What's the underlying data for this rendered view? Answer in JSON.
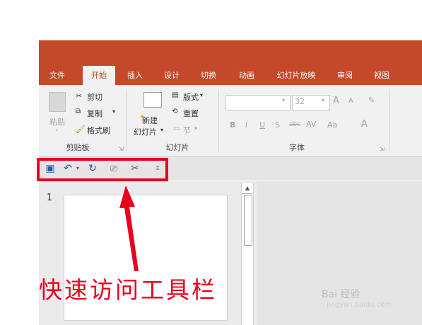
{
  "ribbon_tabs": [
    {
      "label": "文件"
    },
    {
      "label": "开始",
      "active": true
    },
    {
      "label": "插入"
    },
    {
      "label": "设计"
    },
    {
      "label": "切换"
    },
    {
      "label": "动画"
    },
    {
      "label": "幻灯片放映"
    },
    {
      "label": "审阅"
    },
    {
      "label": "视图"
    }
  ],
  "clipboard": {
    "paste": "粘贴",
    "cut": "剪切",
    "copy": "复制",
    "format_painter": "格式刷",
    "group_label": "剪贴板"
  },
  "slides": {
    "new_slide_line1": "新建",
    "new_slide_line2": "幻灯片",
    "layout": "版式",
    "reset": "重置",
    "section": "节",
    "group_label": "幻灯片"
  },
  "font": {
    "size_value": "32",
    "bold": "B",
    "italic": "I",
    "underline": "U",
    "shadow": "S",
    "strikethrough": "abc",
    "spacing": "AV",
    "case": "Aa",
    "color": "A",
    "grow": "A",
    "shrink": "A",
    "group_label": "字体"
  },
  "qat": {
    "save_icon": "save-icon",
    "undo_icon": "undo-icon",
    "redo_icon": "repeat-icon",
    "start_show_icon": "slideshow-icon",
    "cut_icon": "scissors-icon",
    "customize_icon": "customize-icon"
  },
  "slide_panel": {
    "slide_number": "1"
  },
  "annotation": {
    "text": "快速访问工具栏"
  },
  "watermark": {
    "text": "Bai 经验",
    "sub": "jingyan.baidu.com"
  },
  "colors": {
    "accent": "#c4482a",
    "highlight": "#e8001c"
  }
}
